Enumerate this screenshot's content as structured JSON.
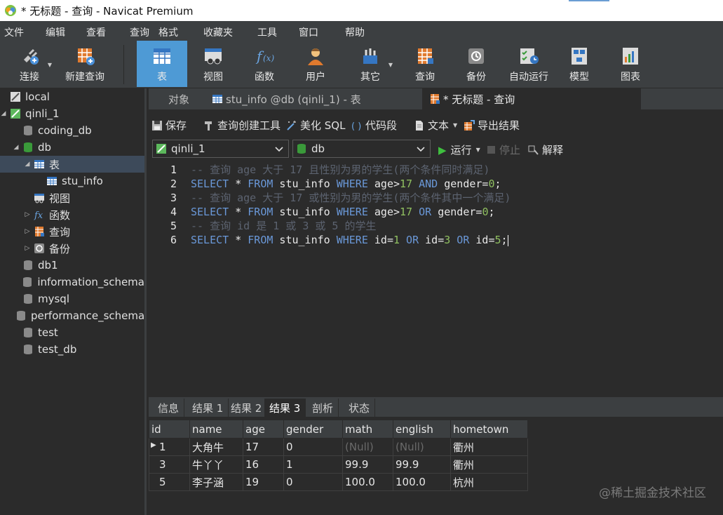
{
  "window": {
    "title": "* 无标题 - 查询 - Navicat Premium"
  },
  "menu": [
    "文件",
    "编辑",
    "查看",
    "查询",
    "格式",
    "收藏夹",
    "工具",
    "窗口",
    "帮助"
  ],
  "toolbar": {
    "items": [
      {
        "label": "连接",
        "icon": "plug-icon"
      },
      {
        "label": "新建查询",
        "icon": "new-query-icon"
      },
      {
        "label": "表",
        "icon": "table-icon"
      },
      {
        "label": "视图",
        "icon": "view-icon"
      },
      {
        "label": "函数",
        "icon": "function-icon"
      },
      {
        "label": "用户",
        "icon": "user-icon"
      },
      {
        "label": "其它",
        "icon": "tools-icon"
      },
      {
        "label": "查询",
        "icon": "query-icon"
      },
      {
        "label": "备份",
        "icon": "backup-icon"
      },
      {
        "label": "自动运行",
        "icon": "schedule-icon"
      },
      {
        "label": "模型",
        "icon": "model-icon"
      },
      {
        "label": "图表",
        "icon": "chart-icon"
      }
    ],
    "active": "表"
  },
  "sidebar": {
    "items": [
      {
        "label": "local"
      },
      {
        "label": "qinli_1"
      },
      {
        "label": "coding_db"
      },
      {
        "label": "db"
      },
      {
        "label": "表"
      },
      {
        "label": "stu_info"
      },
      {
        "label": "视图"
      },
      {
        "label": "函数"
      },
      {
        "label": "查询"
      },
      {
        "label": "备份"
      },
      {
        "label": "db1"
      },
      {
        "label": "information_schema"
      },
      {
        "label": "mysql"
      },
      {
        "label": "performance_schema"
      },
      {
        "label": "test"
      },
      {
        "label": "test_db"
      }
    ]
  },
  "tabs": [
    {
      "label": "对象"
    },
    {
      "label": "stu_info @db (qinli_1) - 表"
    },
    {
      "label": "* 无标题 - 查询"
    }
  ],
  "query_toolbar": {
    "save": "保存",
    "builder": "查询创建工具",
    "beautify": "美化 SQL",
    "snippet": "代码段",
    "text": "文本",
    "export": "导出结果"
  },
  "selectors": {
    "connection": "qinli_1",
    "database": "db",
    "run": "运行",
    "stop": "停止",
    "explain": "解释"
  },
  "editor": {
    "lines": [
      {
        "n": "1",
        "comment": "-- 查询 age 大于 17 且性别为男的学生(两个条件同时满足)"
      },
      {
        "n": "2",
        "sql": {
          "kw1": "SELECT",
          "t1": " * ",
          "kw2": "FROM",
          "t2": " stu_info ",
          "kw3": "WHERE",
          "t3": " age>",
          "n1": "17",
          "kw4": " AND ",
          "t4": "gender=",
          "n2": "0",
          "t5": ";"
        }
      },
      {
        "n": "3",
        "comment": "-- 查询 age 大于 17 或性别为男的学生(两个条件其中一个满足)"
      },
      {
        "n": "4",
        "sql": {
          "kw1": "SELECT",
          "t1": " * ",
          "kw2": "FROM",
          "t2": " stu_info ",
          "kw3": "WHERE",
          "t3": " age>",
          "n1": "17",
          "kw4": " OR ",
          "t4": "gender=",
          "n2": "0",
          "t5": ";"
        }
      },
      {
        "n": "5",
        "comment": "-- 查询 id 是 1 或 3 或 5 的学生"
      },
      {
        "n": "6",
        "sql6": {
          "kw1": "SELECT",
          "t1": " * ",
          "kw2": "FROM",
          "t2": " stu_info ",
          "kw3": "WHERE",
          "t3": " id=",
          "n1": "1",
          "kw4": " OR ",
          "t4": "id=",
          "n2": "3",
          "kw5": " OR ",
          "t5": "id=",
          "n3": "5",
          "t6": ";"
        }
      }
    ]
  },
  "result_tabs": [
    "信息",
    "结果 1",
    "结果 2",
    "结果 3",
    "剖析",
    "状态"
  ],
  "result_active": "结果 3",
  "grid": {
    "columns": [
      "id",
      "name",
      "age",
      "gender",
      "math",
      "english",
      "hometown"
    ],
    "rows": [
      [
        "1",
        "大角牛",
        "17",
        "0",
        "(Null)",
        "(Null)",
        "衢州"
      ],
      [
        "3",
        "牛丫丫",
        "16",
        "1",
        "99.9",
        "99.9",
        "衢州"
      ],
      [
        "5",
        "李子涵",
        "19",
        "0",
        "100.0",
        "100.0",
        "杭州"
      ]
    ]
  },
  "watermark": "@稀土掘金技术社区"
}
